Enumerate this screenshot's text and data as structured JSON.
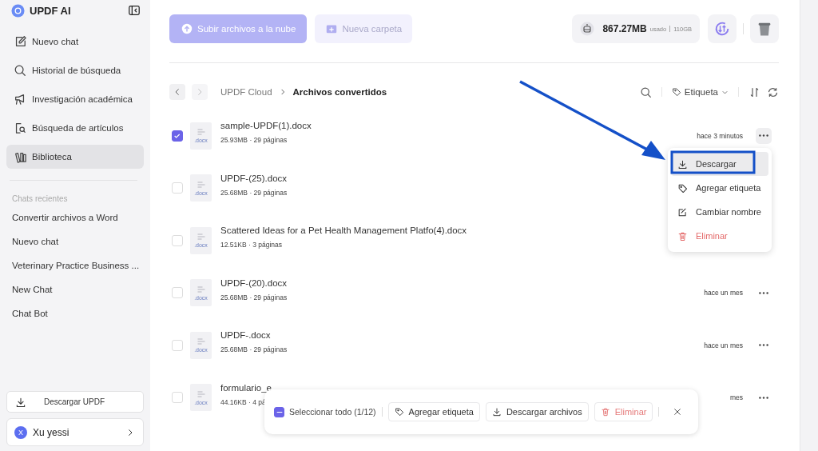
{
  "sidebar": {
    "title": "UPDF AI",
    "nav": [
      {
        "label": "Nuevo chat",
        "selected": false
      },
      {
        "label": "Historial de búsqueda",
        "selected": false
      },
      {
        "label": "Investigación académica",
        "selected": false
      },
      {
        "label": "Búsqueda de artículos",
        "selected": false
      },
      {
        "label": "Biblioteca",
        "selected": true
      }
    ],
    "recent_heading": "Chats recientes",
    "recent": [
      "Convertir archivos a Word",
      "Nuevo chat",
      "Veterinary Practice Business ...",
      "New Chat",
      "Chat Bot"
    ],
    "download_button": "Descargar UPDF",
    "user": {
      "initial": "X",
      "name": "Xu yessi"
    }
  },
  "toolbar": {
    "upload_button": "Subir archivos a la nube",
    "new_folder_button": "Nueva carpeta",
    "storage_used": "867.27MB",
    "storage_label": "usado",
    "storage_total": "110GB"
  },
  "breadcrumb": {
    "root": "UPDF Cloud",
    "current": "Archivos convertidos"
  },
  "list_tools": {
    "tag_filter": "Etiqueta"
  },
  "files": [
    {
      "name": "sample-UPDF(1).docx",
      "meta": "25.93MB · 29 páginas",
      "badge": ".docx",
      "time": "hace 3 minutos",
      "checked": true
    },
    {
      "name": "UPDF-(25).docx",
      "meta": "25.68MB · 29 páginas",
      "badge": ".docx",
      "checked": false
    },
    {
      "name": "Scattered Ideas for a Pet Health Management Platfo(4).docx",
      "meta": "12.51KB · 3 páginas",
      "badge": ".docx",
      "checked": false
    },
    {
      "name": "UPDF-(20).docx",
      "meta": "25.68MB · 29 páginas",
      "badge": ".docx",
      "time": "hace un mes",
      "checked": false
    },
    {
      "name": "UPDF-.docx",
      "meta": "25.68MB · 29 páginas",
      "badge": ".docx",
      "time": "hace un mes",
      "checked": false
    },
    {
      "name": "formulario_e",
      "meta": "44.16KB · 4 pá",
      "badge": ".docx",
      "time": "mes",
      "checked": false
    }
  ],
  "context_menu": [
    {
      "label": "Descargar",
      "kind": "download",
      "selected": true
    },
    {
      "label": "Agregar etiqueta",
      "kind": "tag",
      "selected": false
    },
    {
      "label": "Cambiar nombre",
      "kind": "rename",
      "selected": false
    },
    {
      "label": "Eliminar",
      "kind": "delete",
      "selected": false
    }
  ],
  "selection_bar": {
    "select_all": "Seleccionar todo (1/12)",
    "select_all_checked": true,
    "add_tag": "Agregar etiqueta",
    "download": "Descargar archivos",
    "delete": "Eliminar"
  }
}
